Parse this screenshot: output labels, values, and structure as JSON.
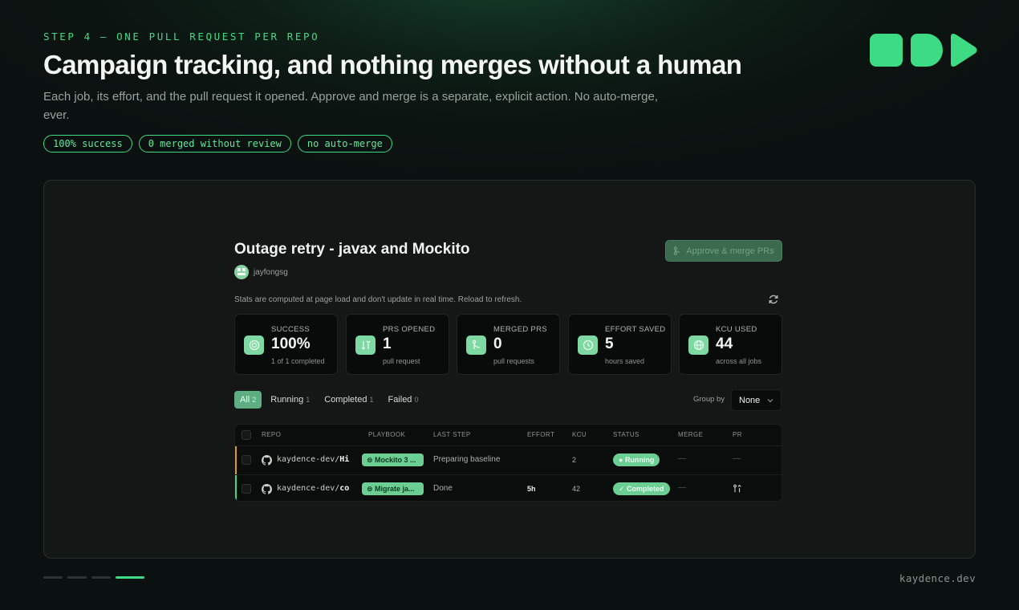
{
  "slide": {
    "eyebrow": "STEP 4 — ONE PULL REQUEST PER REPO",
    "title": "Campaign tracking, and nothing merges without a human",
    "subtitle": "Each job, its effort, and the pull request it opened. Approve and merge is a separate, explicit action. No auto-merge, ever.",
    "chips": [
      "100% success",
      "0 merged without review",
      "no auto-merge"
    ],
    "footer_domain": "kaydence.dev",
    "progress": {
      "current_step": 4,
      "total_steps": 4
    },
    "accent_color": "#3ddc84"
  },
  "app": {
    "title": "Outage retry - javax and Mockito",
    "approve_button": "Approve & merge PRs",
    "username": "jayfongsg",
    "note": "Stats are computed at page load and don't update in real time. Reload to refresh.",
    "stats": [
      {
        "label": "SUCCESS",
        "value": "100%",
        "sub": "1 of 1 completed",
        "icon": "target-icon"
      },
      {
        "label": "PRS OPENED",
        "value": "1",
        "sub": "pull request",
        "icon": "pull-request-icon"
      },
      {
        "label": "MERGED PRS",
        "value": "0",
        "sub": "pull requests",
        "icon": "merge-icon"
      },
      {
        "label": "EFFORT SAVED",
        "value": "5",
        "sub": "hours saved",
        "icon": "clock-icon"
      },
      {
        "label": "KCU USED",
        "value": "44",
        "sub": "across all jobs",
        "icon": "globe-icon"
      }
    ],
    "tabs": [
      {
        "label": "All",
        "count": "2",
        "active": true
      },
      {
        "label": "Running",
        "count": "1"
      },
      {
        "label": "Completed",
        "count": "1"
      },
      {
        "label": "Failed",
        "count": "0"
      }
    ],
    "group_by_label": "Group by",
    "group_by_value": "None",
    "table": {
      "columns": [
        "REPO",
        "PLAYBOOK",
        "LAST STEP",
        "EFFORT",
        "KCU",
        "STATUS",
        "MERGE",
        "PR"
      ],
      "rows": [
        {
          "repo_owner": "kaydence-dev/",
          "repo_name": "Hi",
          "playbook": "Mockito 3 ...",
          "last_step": "Preparing baseline",
          "effort": "",
          "kcu": "2",
          "status": "Running",
          "merge": "—",
          "pr": "—",
          "accent": "#d99a1e"
        },
        {
          "repo_owner": "kaydence-dev/",
          "repo_name": "co",
          "playbook": "Migrate ja...",
          "last_step": "Done",
          "effort": "5h",
          "kcu": "42",
          "status": "Completed",
          "merge": "—",
          "pr": "",
          "accent": "#3ddc84"
        }
      ]
    }
  }
}
